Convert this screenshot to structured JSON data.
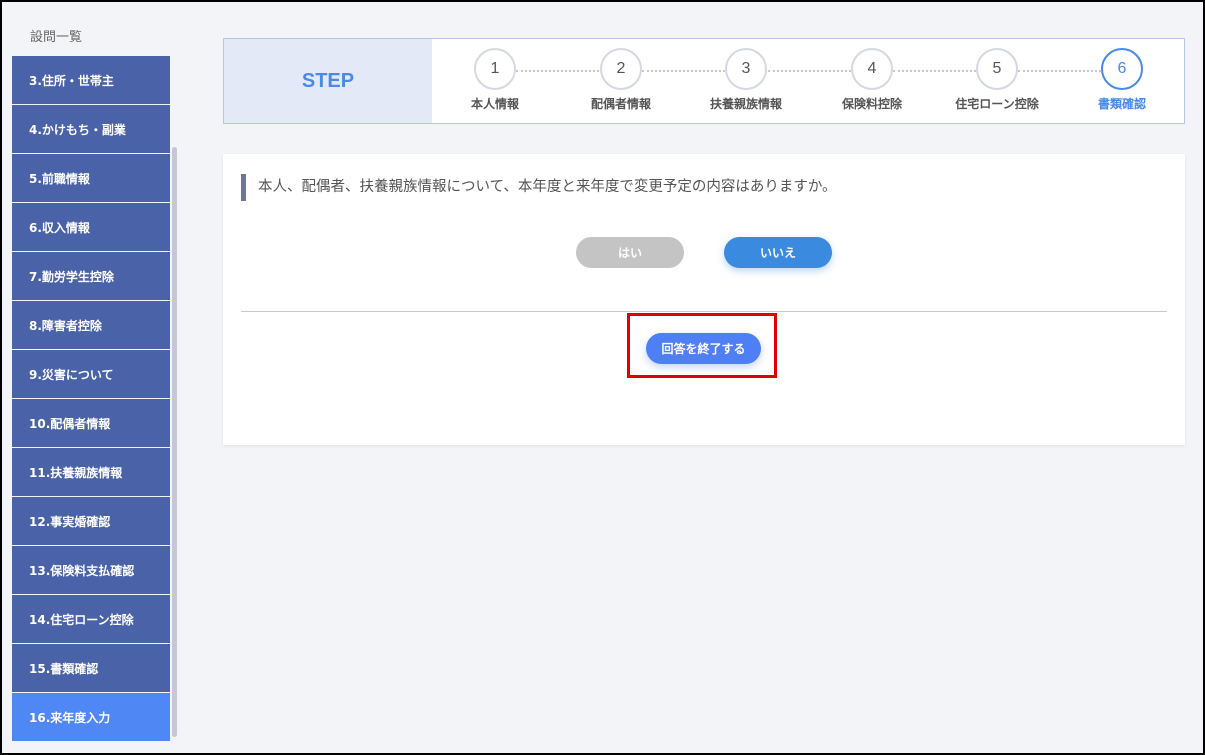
{
  "sidebar": {
    "title": "設問一覧",
    "items": [
      {
        "label": "3.住所・世帯主"
      },
      {
        "label": "4.かけもち・副業"
      },
      {
        "label": "5.前職情報"
      },
      {
        "label": "6.収入情報"
      },
      {
        "label": "7.勤労学生控除"
      },
      {
        "label": "8.障害者控除"
      },
      {
        "label": "9.災害について"
      },
      {
        "label": "10.配偶者情報"
      },
      {
        "label": "11.扶養親族情報"
      },
      {
        "label": "12.事実婚確認"
      },
      {
        "label": "13.保険料支払確認"
      },
      {
        "label": "14.住宅ローン控除"
      },
      {
        "label": "15.書類確認"
      },
      {
        "label": "16.来年度入力"
      }
    ],
    "active_index": 13
  },
  "stepper": {
    "label": "STEP",
    "steps": [
      {
        "num": "1",
        "label": "本人情報"
      },
      {
        "num": "2",
        "label": "配偶者情報"
      },
      {
        "num": "3",
        "label": "扶養親族情報"
      },
      {
        "num": "4",
        "label": "保険料控除"
      },
      {
        "num": "5",
        "label": "住宅ローン控除"
      },
      {
        "num": "6",
        "label": "書類確認"
      }
    ],
    "active_step": 6
  },
  "question": {
    "text": "本人、配偶者、扶養親族情報について、本年度と来年度で変更予定の内容はありますか。",
    "yes_label": "はい",
    "no_label": "いいえ"
  },
  "finish_button": {
    "label": "回答を終了する"
  },
  "colors": {
    "sidebar_item": "#4a63a8",
    "sidebar_active": "#4f88f5",
    "accent": "#4a8ae6",
    "no_button": "#3a8be0",
    "yes_button": "#c4c4c4",
    "finish_button": "#4f7ff5",
    "highlight": "#e00000"
  }
}
